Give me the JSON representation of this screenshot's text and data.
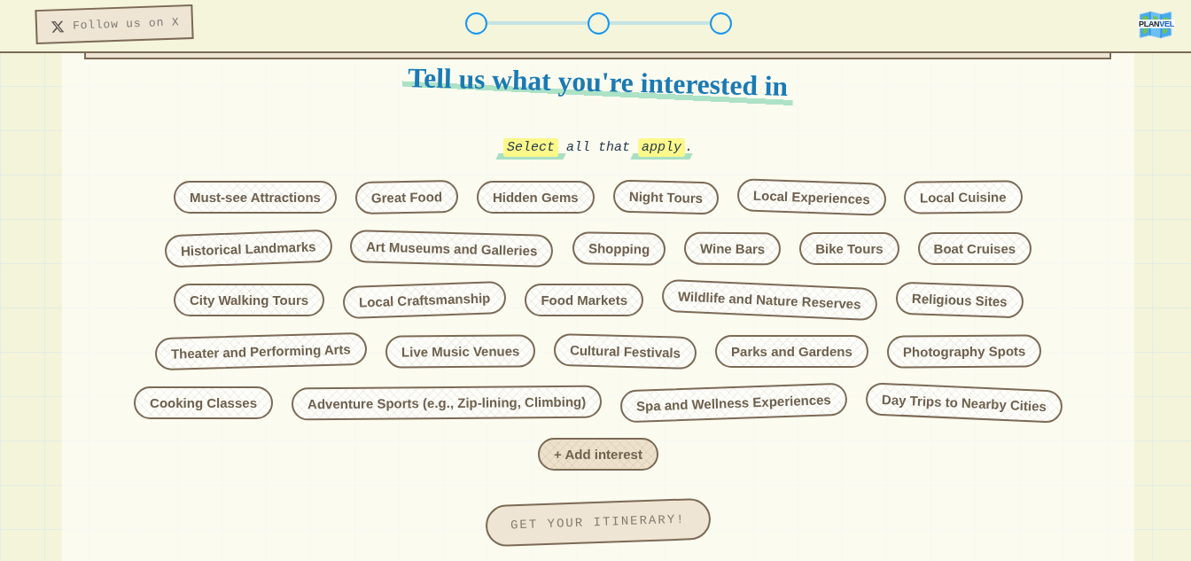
{
  "header": {
    "follow_button": "Follow us on X",
    "steps": [
      {
        "completed": false
      },
      {
        "completed": false
      },
      {
        "completed": false
      }
    ],
    "logo": {
      "text_parts": [
        "PLAN",
        "VEL"
      ]
    }
  },
  "title": "Tell us what you're interested in",
  "subtitle": [
    {
      "text": "Select",
      "highlighted": true
    },
    {
      "text": " all that ",
      "highlighted": false
    },
    {
      "text": "apply",
      "highlighted": true
    },
    {
      "text": ".",
      "highlighted": false
    }
  ],
  "interests": [
    {
      "label": "Must-see Attractions",
      "selected": false
    },
    {
      "label": "Great Food",
      "selected": false
    },
    {
      "label": "Hidden Gems",
      "selected": false
    },
    {
      "label": "Night Tours",
      "selected": false
    },
    {
      "label": "Local Experiences",
      "selected": false
    },
    {
      "label": "Local Cuisine",
      "selected": false
    },
    {
      "label": "Historical Landmarks",
      "selected": false
    },
    {
      "label": "Art Museums and Galleries",
      "selected": false
    },
    {
      "label": "Shopping",
      "selected": false
    },
    {
      "label": "Wine Bars",
      "selected": false
    },
    {
      "label": "Bike Tours",
      "selected": false
    },
    {
      "label": "Boat Cruises",
      "selected": false
    },
    {
      "label": "City Walking Tours",
      "selected": false
    },
    {
      "label": "Local Craftsmanship",
      "selected": false
    },
    {
      "label": "Food Markets",
      "selected": false
    },
    {
      "label": "Wildlife and Nature Reserves",
      "selected": false
    },
    {
      "label": "Religious Sites",
      "selected": false
    },
    {
      "label": "Theater and Performing Arts",
      "selected": false
    },
    {
      "label": "Live Music Venues",
      "selected": false
    },
    {
      "label": "Cultural Festivals",
      "selected": false
    },
    {
      "label": "Parks and Gardens",
      "selected": false
    },
    {
      "label": "Photography Spots",
      "selected": false
    },
    {
      "label": "Cooking Classes",
      "selected": false
    },
    {
      "label": "Adventure Sports (e.g., Zip-lining, Climbing)",
      "selected": false
    },
    {
      "label": "Spa and Wellness Experiences",
      "selected": false
    },
    {
      "label": "Day Trips to Nearby Cities",
      "selected": false
    }
  ],
  "add_button": "+ Add interest",
  "submit_button": "GET YOUR ITINERARY!"
}
